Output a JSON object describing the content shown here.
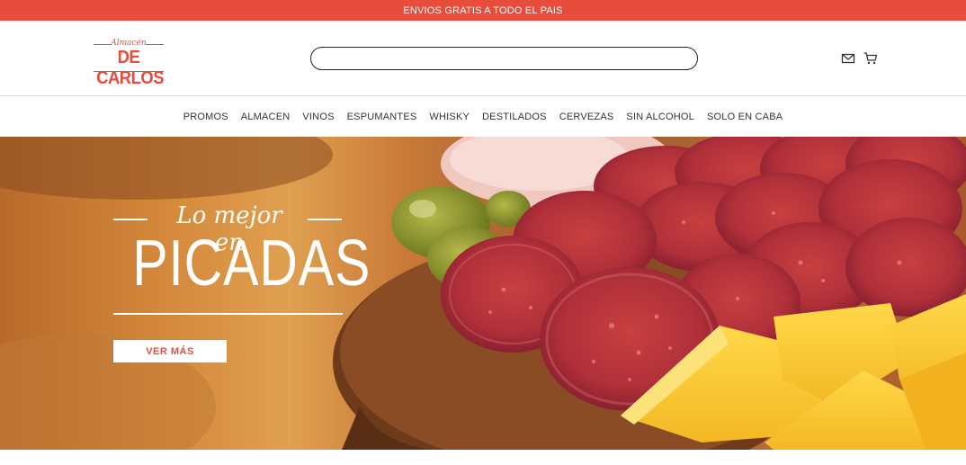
{
  "topbar": {
    "text": "ENVIOS GRATIS A TODO EL PAIS"
  },
  "logo": {
    "small_text": "Almacén",
    "big_text": "DE CARLOS"
  },
  "search": {
    "value": "",
    "placeholder": ""
  },
  "icons": {
    "mail": "mail-icon",
    "cart": "cart-icon"
  },
  "nav": {
    "items": [
      {
        "label": "PROMOS"
      },
      {
        "label": "ALMACEN"
      },
      {
        "label": "VINOS"
      },
      {
        "label": "ESPUMANTES"
      },
      {
        "label": "WHISKY"
      },
      {
        "label": "DESTILADOS"
      },
      {
        "label": "CERVEZAS"
      },
      {
        "label": "SIN ALCOHOL"
      },
      {
        "label": "SOLO EN CABA"
      }
    ]
  },
  "hero": {
    "script_text": "Lo mejor en",
    "title": "PICADAS",
    "button_label": "VER MÁS"
  },
  "colors": {
    "accent": "#e84c3a",
    "text": "#333333"
  }
}
